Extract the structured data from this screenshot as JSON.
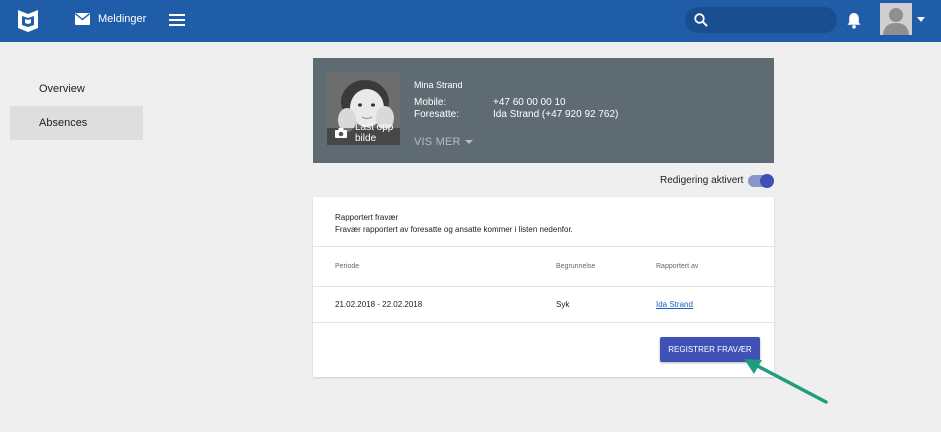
{
  "header": {
    "messages_label": "Meldinger",
    "search_placeholder": "",
    "brand_color": "#1f5da8"
  },
  "sidenav": {
    "items": [
      {
        "label": "Overview",
        "active": false
      },
      {
        "label": "Absences",
        "active": true
      }
    ]
  },
  "profile": {
    "name": "Mina Strand",
    "upload_label": "Last opp bilde",
    "fields": [
      {
        "label": "Mobile:",
        "value": "+47 60 00 00 10"
      },
      {
        "label": "Foresatte:",
        "value": "Ida Strand (+47 920 92 762)"
      }
    ],
    "show_more_label": "VIS MER"
  },
  "editing": {
    "label": "Redigering aktivert",
    "enabled": true
  },
  "absences": {
    "title": "Rapportert fravær",
    "description": "Fravær rapportert av foresatte og ansatte kommer i listen nedenfor.",
    "columns": [
      "Periode",
      "Begrunnelse",
      "Rapportert av"
    ],
    "rows": [
      {
        "period": "21.02.2018 - 22.02.2018",
        "reason": "Syk",
        "reported_by": "Ida Strand"
      }
    ],
    "register_button": "REGISTRER FRAVÆR",
    "accent_color": "#3f51b5"
  },
  "annotation": {
    "arrow_color": "#1e9e7e"
  }
}
